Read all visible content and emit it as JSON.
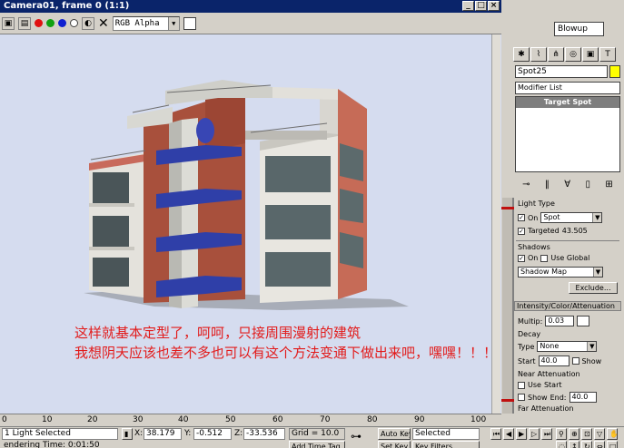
{
  "render_window": {
    "title": "Camera01, frame 0 (1:1)",
    "channel": "RGB Alpha",
    "close_glyph": "✕",
    "win_buttons": [
      "_",
      "□",
      "×"
    ]
  },
  "caption": {
    "line1": "这样就基本定型了，呵呵，只接周围漫射的建筑",
    "line2": "我想阴天应该也差不多也可以有这个方法变通下做出来吧，嘿嘿！！！",
    "color": "#e21b1b"
  },
  "command_panel": {
    "top_select": "Blowup",
    "object_name": "Spot25",
    "modifier_list": "Modifier List",
    "stack_item": "Target Spot",
    "light_type": {
      "header": "Light Type",
      "on_label": "On",
      "type_value": "Spot",
      "targeted_label": "Targeted",
      "target_distance": "43.505"
    },
    "shadows": {
      "header": "Shadows",
      "on_label": "On",
      "use_global_label": "Use Global",
      "shadow_type": "Shadow Map",
      "exclude_label": "Exclude..."
    },
    "intensity": {
      "header": "Intensity/Color/Attenuation",
      "multiplier_label": "Multip:",
      "multiplier_value": "0.03"
    },
    "decay": {
      "header": "Decay",
      "type_label": "Type",
      "type_value": "None",
      "start_label": "Start",
      "start_value": "40.0",
      "show_label": "Show"
    },
    "near_atten": {
      "header": "Near Attenuation",
      "use_label": "Use",
      "start_label": "Start",
      "show_label": "Show",
      "end_label": "End:",
      "end_value": "40.0"
    },
    "far_atten": {
      "header": "Far Attenuation"
    }
  },
  "timeline": {
    "ticks": [
      "0",
      "10",
      "20",
      "30",
      "40",
      "50",
      "60",
      "70",
      "80",
      "90",
      "100"
    ]
  },
  "status_bar": {
    "selection": "1 Light Selected",
    "prompt": "endering Time: 0:01:50",
    "x_label": "X:",
    "x_value": "38.179",
    "y_label": "Y:",
    "y_value": "-0.512",
    "z_label": "Z:",
    "z_value": "-33.536",
    "grid": "Grid = 10.0",
    "add_time_tag": "Add Time Tag",
    "auto_key": "Auto Key",
    "selected": "Selected",
    "set_key": "Set Key",
    "key_filters": "Key Filters..."
  }
}
